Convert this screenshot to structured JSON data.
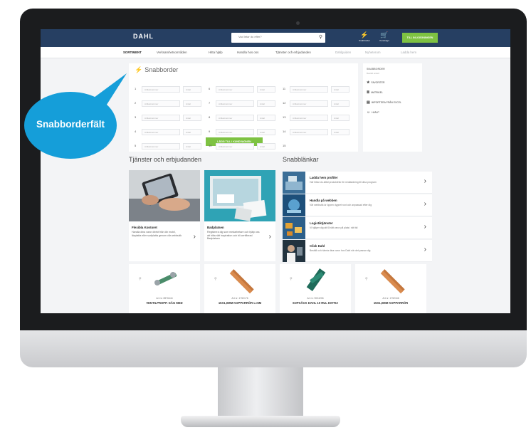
{
  "callout": {
    "label": "Snabborderfält",
    "color": "#159ed9"
  },
  "header": {
    "logo": "DAHL",
    "search_placeholder": "Vad letar du efter?",
    "icon1_label": "Snabborder",
    "icon2_label": "Kundvagn",
    "login_label": "TILL INLOGGNINGEN"
  },
  "nav": {
    "items": [
      "SORTIMENT",
      "Verksamhetsområden",
      "Hitta hjälp",
      "Handla hos oss",
      "Tjänster och erbjudanden",
      "Dahlguiden",
      "Nyheterum",
      "Ladda hem"
    ]
  },
  "snabborder": {
    "title": "Snabborder",
    "row_numbers": [
      "1",
      "6",
      "11",
      "2",
      "7",
      "12",
      "3",
      "8",
      "13",
      "4",
      "9",
      "14",
      "5",
      "10",
      "15"
    ],
    "artikel_placeholder": "Artikelnummer",
    "antal_placeholder": "Antal",
    "add_button": "LÄGG TILL I KUNDVAGNEN"
  },
  "sidebar": {
    "heading": "SNABBORDER",
    "sub": "Beställ enkelt",
    "items": [
      "FAVORITER",
      "MATRIKEL",
      "IMPORTERA FRÅN EXCEL",
      "HJÄLP"
    ]
  },
  "services": {
    "title": "Tjänster och erbjudanden",
    "cards": [
      {
        "title": "Flexibla Kontoret",
        "desc": "Handla dina varor direkt från din mobil, läsplatta eller surfplatta genom vår webbutik"
      },
      {
        "title": "Badplatsen",
        "desc": "Registrera dig som medarbetare och hjälp oss att hitta rätt inspiration och bli certifierad Badplatsen"
      }
    ]
  },
  "quicklinks": {
    "title": "Snabblänkar",
    "items": [
      {
        "title": "Ladda hem profiler",
        "desc": "Här hittar du alltid produktinfo för nedladdning till dina program"
      },
      {
        "title": "Handla på webben",
        "desc": "Vår webbutik är öppen dygnet runt och anpassad efter dig"
      },
      {
        "title": "Logistiktjänster",
        "desc": "Vi hjälper dig att få rätt varor på plats i rätt tid"
      },
      {
        "title": "Click Dahl",
        "desc": "Beställ och hämta dina varor hos Dahl när det passar dig"
      }
    ]
  },
  "products": [
    {
      "art": "Art nr: 8576444",
      "name": "VENTILPROPP. GÄG MED"
    },
    {
      "art": "Art nr: 1752176",
      "name": "15X1,0MM KOPPARRÖR L=5M"
    },
    {
      "art": "Art nr: 9024206",
      "name": "SOPSÄCK DAHL 10 RUL EXTRA"
    },
    {
      "art": "Art nr: 1752166",
      "name": "15X1,0MM KOPPARRÖR"
    }
  ],
  "colors": {
    "header_bg": "#263f62",
    "accent_green": "#7ec242"
  }
}
